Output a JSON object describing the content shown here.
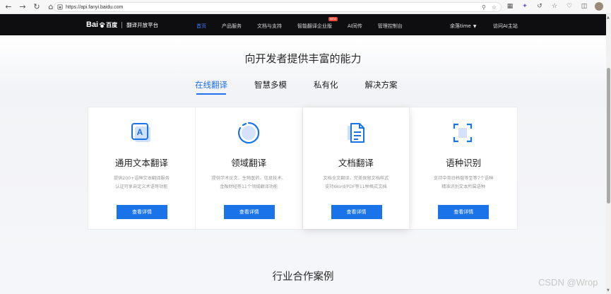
{
  "browser": {
    "url": "https://api.fanyi.baidu.com"
  },
  "header": {
    "logo_bai": "Bai",
    "logo_cn": "百度",
    "logo_name": "翻译开放平台",
    "nav": [
      {
        "label": "首页",
        "active": true
      },
      {
        "label": "产品服务",
        "active": false
      },
      {
        "label": "文档与支持",
        "active": false
      },
      {
        "label": "智能翻译企业版",
        "active": false,
        "badge": "NEW"
      },
      {
        "label": "AI同传",
        "active": false
      },
      {
        "label": "管理控制台",
        "active": false
      }
    ],
    "user": "余落time",
    "visit_link": "访问AI主站"
  },
  "main": {
    "section_title": "向开发者提供丰富的能力",
    "tabs": [
      {
        "label": "在线翻译",
        "active": true
      },
      {
        "label": "智慧多模",
        "active": false
      },
      {
        "label": "私有化",
        "active": false
      },
      {
        "label": "解决方案",
        "active": false
      }
    ],
    "cards": [
      {
        "title": "通用文本翻译",
        "desc1": "提供200+语种文本翻译服务",
        "desc2": "认证可享自定义术语等功能",
        "button": "查看详情",
        "icon": "text-translate-icon"
      },
      {
        "title": "领域翻译",
        "desc1": "提供学术论文、生物医药、信息技术、",
        "desc2": "金融财经等11个领域翻译功能",
        "button": "查看详情",
        "icon": "domain-circle-icon"
      },
      {
        "title": "文档翻译",
        "desc1": "文档全文翻译，完美保留文档样式",
        "desc2": "支持Word/PDF等11种格式文档",
        "button": "查看详情",
        "icon": "document-icon"
      },
      {
        "title": "语种识别",
        "desc1": "支持中英日韩俄等至等7个语种",
        "desc2": "精准识别文本所属语种",
        "button": "查看详情",
        "icon": "scan-frame-icon"
      }
    ],
    "industry_title": "行业合作案例"
  },
  "watermark": "CSDN @Wrop",
  "colors": {
    "accent": "#1a73e8",
    "header_bg": "#0e0e10",
    "nav_active": "#3c7bff"
  }
}
